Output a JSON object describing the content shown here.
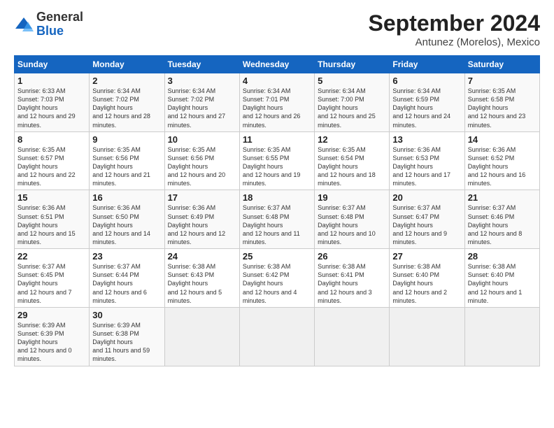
{
  "logo": {
    "general": "General",
    "blue": "Blue"
  },
  "header": {
    "month": "September 2024",
    "location": "Antunez (Morelos), Mexico"
  },
  "weekdays": [
    "Sunday",
    "Monday",
    "Tuesday",
    "Wednesday",
    "Thursday",
    "Friday",
    "Saturday"
  ],
  "weeks": [
    [
      {
        "day": "1",
        "sunrise": "6:33 AM",
        "sunset": "7:03 PM",
        "daylight": "12 hours and 29 minutes."
      },
      {
        "day": "2",
        "sunrise": "6:34 AM",
        "sunset": "7:02 PM",
        "daylight": "12 hours and 28 minutes."
      },
      {
        "day": "3",
        "sunrise": "6:34 AM",
        "sunset": "7:02 PM",
        "daylight": "12 hours and 27 minutes."
      },
      {
        "day": "4",
        "sunrise": "6:34 AM",
        "sunset": "7:01 PM",
        "daylight": "12 hours and 26 minutes."
      },
      {
        "day": "5",
        "sunrise": "6:34 AM",
        "sunset": "7:00 PM",
        "daylight": "12 hours and 25 minutes."
      },
      {
        "day": "6",
        "sunrise": "6:34 AM",
        "sunset": "6:59 PM",
        "daylight": "12 hours and 24 minutes."
      },
      {
        "day": "7",
        "sunrise": "6:35 AM",
        "sunset": "6:58 PM",
        "daylight": "12 hours and 23 minutes."
      }
    ],
    [
      {
        "day": "8",
        "sunrise": "6:35 AM",
        "sunset": "6:57 PM",
        "daylight": "12 hours and 22 minutes."
      },
      {
        "day": "9",
        "sunrise": "6:35 AM",
        "sunset": "6:56 PM",
        "daylight": "12 hours and 21 minutes."
      },
      {
        "day": "10",
        "sunrise": "6:35 AM",
        "sunset": "6:56 PM",
        "daylight": "12 hours and 20 minutes."
      },
      {
        "day": "11",
        "sunrise": "6:35 AM",
        "sunset": "6:55 PM",
        "daylight": "12 hours and 19 minutes."
      },
      {
        "day": "12",
        "sunrise": "6:35 AM",
        "sunset": "6:54 PM",
        "daylight": "12 hours and 18 minutes."
      },
      {
        "day": "13",
        "sunrise": "6:36 AM",
        "sunset": "6:53 PM",
        "daylight": "12 hours and 17 minutes."
      },
      {
        "day": "14",
        "sunrise": "6:36 AM",
        "sunset": "6:52 PM",
        "daylight": "12 hours and 16 minutes."
      }
    ],
    [
      {
        "day": "15",
        "sunrise": "6:36 AM",
        "sunset": "6:51 PM",
        "daylight": "12 hours and 15 minutes."
      },
      {
        "day": "16",
        "sunrise": "6:36 AM",
        "sunset": "6:50 PM",
        "daylight": "12 hours and 14 minutes."
      },
      {
        "day": "17",
        "sunrise": "6:36 AM",
        "sunset": "6:49 PM",
        "daylight": "12 hours and 12 minutes."
      },
      {
        "day": "18",
        "sunrise": "6:37 AM",
        "sunset": "6:48 PM",
        "daylight": "12 hours and 11 minutes."
      },
      {
        "day": "19",
        "sunrise": "6:37 AM",
        "sunset": "6:48 PM",
        "daylight": "12 hours and 10 minutes."
      },
      {
        "day": "20",
        "sunrise": "6:37 AM",
        "sunset": "6:47 PM",
        "daylight": "12 hours and 9 minutes."
      },
      {
        "day": "21",
        "sunrise": "6:37 AM",
        "sunset": "6:46 PM",
        "daylight": "12 hours and 8 minutes."
      }
    ],
    [
      {
        "day": "22",
        "sunrise": "6:37 AM",
        "sunset": "6:45 PM",
        "daylight": "12 hours and 7 minutes."
      },
      {
        "day": "23",
        "sunrise": "6:37 AM",
        "sunset": "6:44 PM",
        "daylight": "12 hours and 6 minutes."
      },
      {
        "day": "24",
        "sunrise": "6:38 AM",
        "sunset": "6:43 PM",
        "daylight": "12 hours and 5 minutes."
      },
      {
        "day": "25",
        "sunrise": "6:38 AM",
        "sunset": "6:42 PM",
        "daylight": "12 hours and 4 minutes."
      },
      {
        "day": "26",
        "sunrise": "6:38 AM",
        "sunset": "6:41 PM",
        "daylight": "12 hours and 3 minutes."
      },
      {
        "day": "27",
        "sunrise": "6:38 AM",
        "sunset": "6:40 PM",
        "daylight": "12 hours and 2 minutes."
      },
      {
        "day": "28",
        "sunrise": "6:38 AM",
        "sunset": "6:40 PM",
        "daylight": "12 hours and 1 minute."
      }
    ],
    [
      {
        "day": "29",
        "sunrise": "6:39 AM",
        "sunset": "6:39 PM",
        "daylight": "12 hours and 0 minutes."
      },
      {
        "day": "30",
        "sunrise": "6:39 AM",
        "sunset": "6:38 PM",
        "daylight": "11 hours and 59 minutes."
      },
      null,
      null,
      null,
      null,
      null
    ]
  ]
}
